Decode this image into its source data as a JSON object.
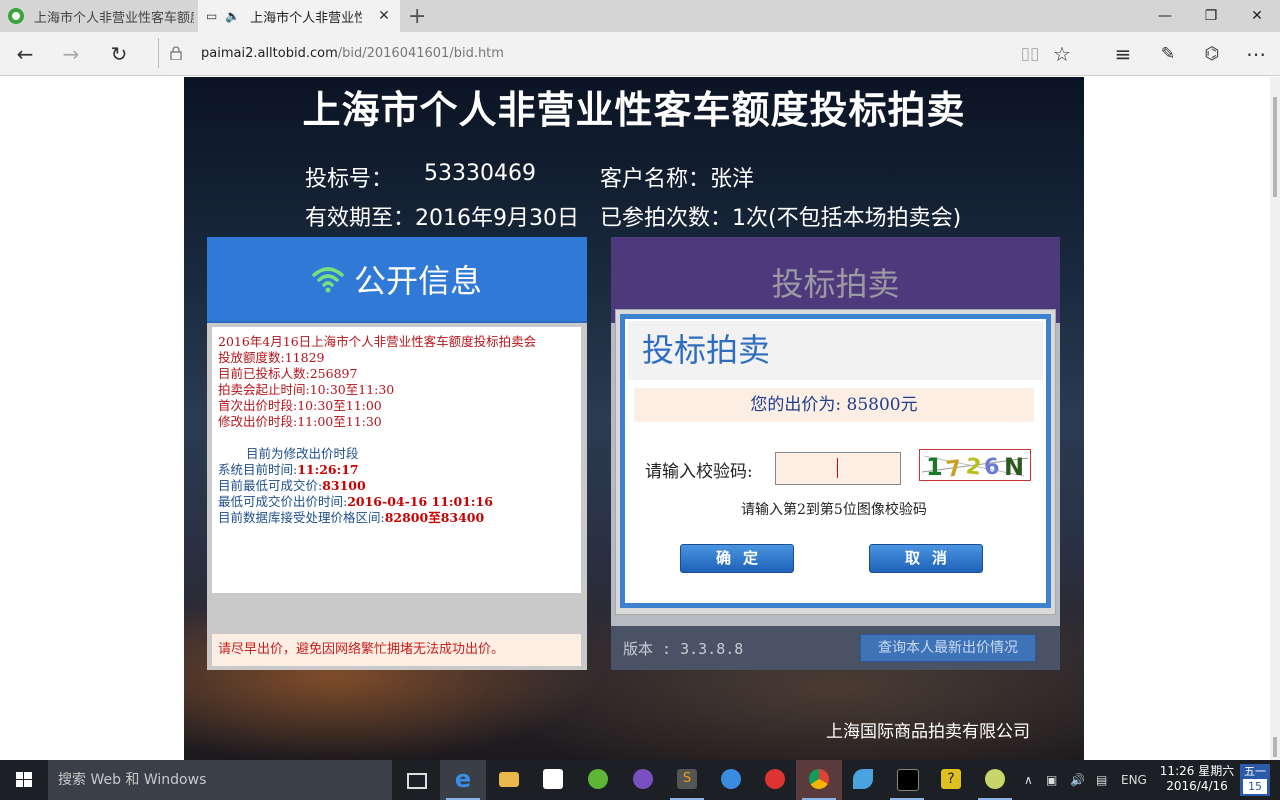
{
  "browser": {
    "tabs": [
      {
        "title": "上海市个人非营业性客车额度"
      },
      {
        "title": "上海市个人非营业性"
      }
    ],
    "address": {
      "domain": "paimai2.alltobid.com",
      "path": "/bid/2016041601/bid.htm"
    }
  },
  "page": {
    "title": "上海市个人非营业性客车额度投标拍卖",
    "bid_no_label": "投标号：",
    "bid_no": "53330469",
    "customer_label": "客户名称：张洋",
    "valid_label": "有效期至：2016年9月30日",
    "participated_label": "已参拍次数：1次(不包括本场拍卖会)",
    "company": "上海国际商品拍卖有限公司"
  },
  "left_panel": {
    "title": "公开信息",
    "lines": [
      "2016年4月16日上海市个人非营业性客车额度投标拍卖会",
      "投放额度数:11829",
      "目前已投标人数:256897",
      "拍卖会起止时间:10:30至11:30",
      "首次出价时段:10:30至11:00",
      "修改出价时段:11:00至11:30"
    ],
    "phase": "目前为修改出价时段",
    "sys_time_label": "系统目前时间:",
    "sys_time": "11:26:17",
    "min_price_label": "目前最低可成交价:",
    "min_price": "83100",
    "min_price_time_label": "最低可成交价出价时间:",
    "min_price_time": "2016-04-16 11:01:16",
    "range_label": "目前数据库接受处理价格区间:",
    "range": "82800至83400",
    "warning": "请尽早出价，避免因网络繁忙拥堵无法成功出价。"
  },
  "right_panel": {
    "title": "投标拍卖",
    "version": "版本 : 3.3.8.8",
    "query_button": "查询本人最新出价情况"
  },
  "dialog": {
    "title": "投标拍卖",
    "price_text": "您的出价为: 85800元",
    "code_label": "请输入校验码:",
    "code_value": "",
    "captcha_text": "1726N",
    "hint": "请输入第2到第5位图像校验码",
    "ok": "确定",
    "cancel": "取消"
  },
  "taskbar": {
    "search_placeholder": "搜索 Web 和 Windows",
    "lang": "ENG",
    "time": "11:26 星期六",
    "date": "2016/4/16",
    "ime_top": "五一",
    "ime_bottom": "15"
  },
  "colors": {
    "left_header": "#3179d6",
    "right_header": "#4d3a7c",
    "dialog_border": "#3d82d0",
    "info_red": "#b8141b",
    "info_blue": "#1d4f8f"
  }
}
